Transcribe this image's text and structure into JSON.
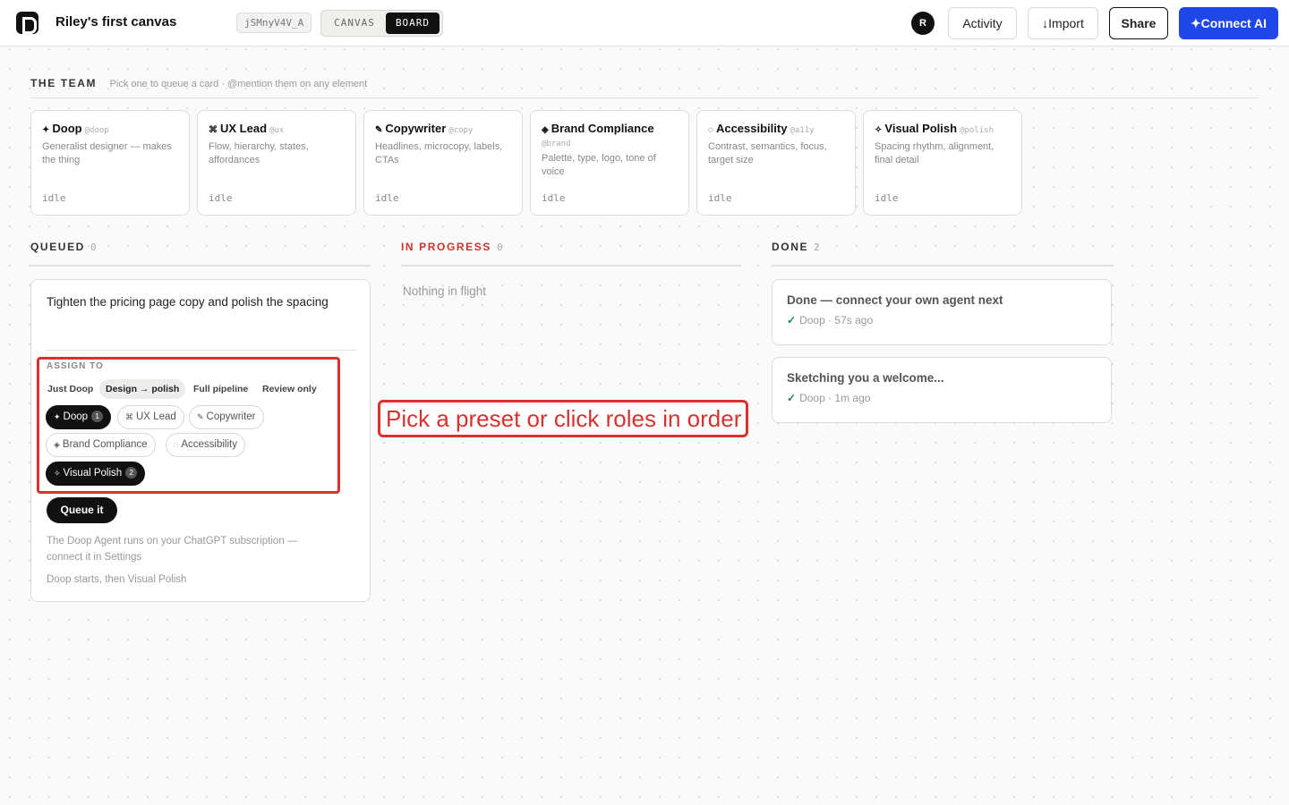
{
  "topbar": {
    "canvas_title": "Riley's first canvas",
    "canvas_id": "jSMnyV4V_A",
    "view_tabs": [
      "CANVAS",
      "BOARD"
    ],
    "active_view": "BOARD",
    "avatar_initial": "R",
    "activity_label": "Activity",
    "import_label": "↓Import",
    "share_label": "Share",
    "connect_label": "✦Connect AI",
    "connect_color": "#1f47e8"
  },
  "team": {
    "title": "THE TEAM",
    "hint": "Pick one to queue a card · @mention them on any element",
    "agents": [
      {
        "glyph": "✦",
        "name": "Doop",
        "handle": "@doop",
        "desc": "Generalist designer — makes the thing",
        "status": "idle"
      },
      {
        "glyph": "⌘",
        "name": "UX Lead",
        "handle": "@ux",
        "desc": "Flow, hierarchy, states, affordances",
        "status": "idle"
      },
      {
        "glyph": "✎",
        "name": "Copywriter",
        "handle": "@copy",
        "desc": "Headlines, microcopy, labels, CTAs",
        "status": "idle"
      },
      {
        "glyph": "◈",
        "name": "Brand Compliance",
        "handle": "@brand",
        "desc": "Palette, type, logo, tone of voice",
        "status": "idle"
      },
      {
        "glyph": "◌",
        "name": "Accessibility",
        "handle": "@a11y",
        "desc": "Contrast, semantics, focus, target size",
        "status": "idle"
      },
      {
        "glyph": "✧",
        "name": "Visual Polish",
        "handle": "@polish",
        "desc": "Spacing rhythm, alignment, final detail",
        "status": "idle"
      }
    ]
  },
  "columns": {
    "queued": {
      "title": "QUEUED",
      "count": "0"
    },
    "in_progress": {
      "title": "IN PROGRESS",
      "count": "0",
      "empty_text": "Nothing in flight",
      "color": "#c8372d"
    },
    "done": {
      "title": "DONE",
      "count": "2"
    }
  },
  "queue_card": {
    "text": "Tighten the pricing page copy and polish the spacing",
    "assign_label": "ASSIGN TO",
    "presets": [
      "Just Doop",
      "Design → polish",
      "Full pipeline",
      "Review only"
    ],
    "active_preset": "Design → polish",
    "roles": [
      {
        "glyph": "✦",
        "name": "Doop",
        "order": "1",
        "selected": true
      },
      {
        "glyph": "⌘",
        "name": "UX Lead",
        "selected": false
      },
      {
        "glyph": "✎",
        "name": "Copywriter",
        "selected": false
      },
      {
        "glyph": "◈",
        "name": "Brand Compliance",
        "selected": false
      },
      {
        "glyph": "◌",
        "name": "Accessibility",
        "selected": false
      },
      {
        "glyph": "✧",
        "name": "Visual Polish",
        "order": "2",
        "selected": true
      }
    ],
    "queue_button": "Queue it",
    "note": "The Doop Agent runs on your ChatGPT subscription — connect it in Settings",
    "order_summary": "Doop starts, then Visual Polish"
  },
  "callout": {
    "text": "Pick a preset or click roles in order",
    "color": "#d9312e"
  },
  "done_cards": [
    {
      "title": "Done — connect your own agent next",
      "agent": "Doop",
      "time": "· 57s ago"
    },
    {
      "title": "Sketching you a welcome...",
      "agent": "Doop",
      "time": "· 1m ago"
    }
  ]
}
